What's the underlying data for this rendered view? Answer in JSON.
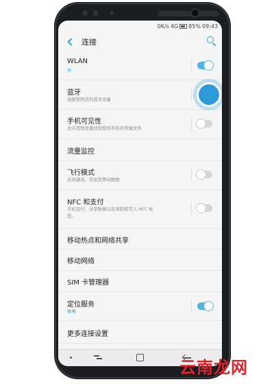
{
  "statusbar": {
    "speed": "0K/s",
    "network": "4G",
    "battery": "85%",
    "time": "09:43"
  },
  "header": {
    "title": "连接",
    "back_icon": "back-arrow-icon",
    "search_icon": "search-icon"
  },
  "items": [
    {
      "label": "WLAN",
      "sub": "开",
      "toggle": true
    },
    {
      "label": "蓝牙",
      "sub": "连接至附近的蓝牙设备",
      "toggle": true
    },
    {
      "label": "手机可见性",
      "sub": "允许其他设备找到您的手机并传输文件",
      "toggle": false
    },
    {
      "label": "流量监控"
    },
    {
      "label": "飞行模式",
      "sub": "关闭通话、信息及移动数据",
      "toggle": false
    },
    {
      "label": "NFC 和支付",
      "sub": "手机支付、分享数据以及读取和写入 NFC 标",
      "sub2": "签。",
      "toggle": false
    },
    {
      "label": "移动热点和网络共享"
    },
    {
      "label": "移动网络"
    },
    {
      "label": "SIM 卡管理器"
    },
    {
      "label": "定位服务",
      "sub": "省电",
      "toggle": true
    },
    {
      "label": "更多连接设置"
    }
  ],
  "accent_color": "#2aa3d8",
  "navbar": {
    "icons": [
      "dot-icon",
      "recent-apps-icon",
      "home-icon",
      "back-icon"
    ]
  },
  "watermark": "云南龙网"
}
